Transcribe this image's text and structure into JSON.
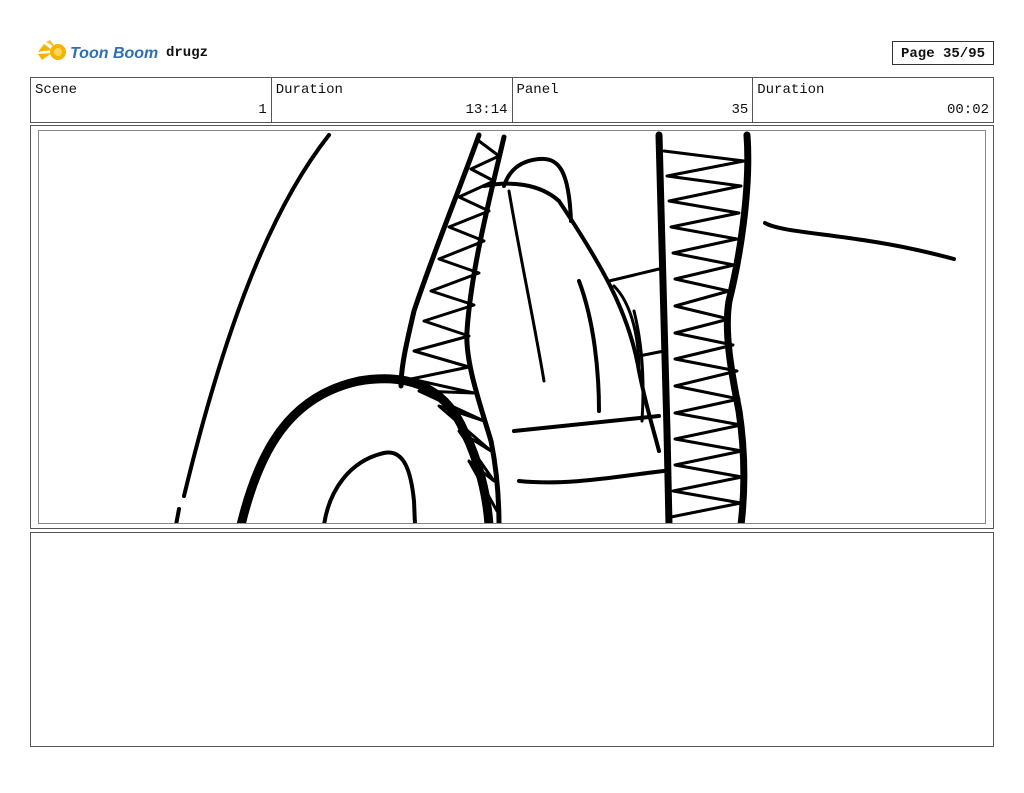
{
  "header": {
    "brand": "Toon Boom",
    "project_name": "drugz",
    "page_label": "Page 35/95"
  },
  "info": {
    "scene_label": "Scene",
    "scene_value": "1",
    "scene_duration_label": "Duration",
    "scene_duration_value": "13:14",
    "panel_label": "Panel",
    "panel_value": "35",
    "panel_duration_label": "Duration",
    "panel_duration_value": "00:02"
  },
  "colors": {
    "logo_accent": "#f5b400",
    "logo_text": "#2e6fb4",
    "ink": "#000000"
  }
}
